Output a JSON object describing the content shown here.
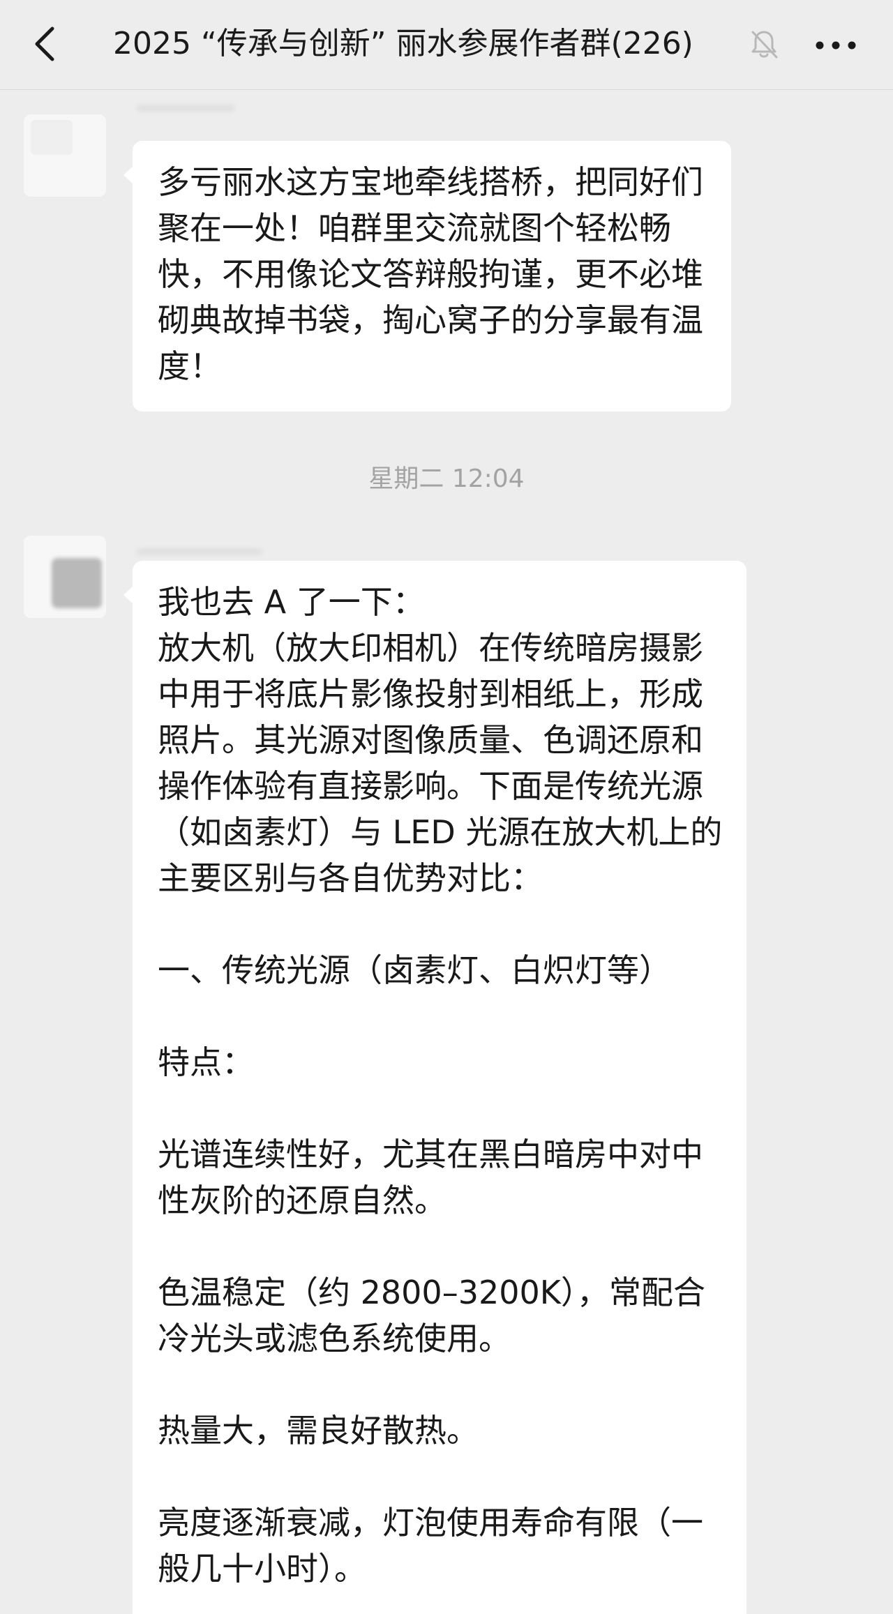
{
  "header": {
    "title": "2025 “传承与创新” 丽水参展作者群(226)",
    "back_icon": "chevron-left-icon",
    "mute_icon": "bell-off-icon",
    "more_icon": "more-horizontal-icon"
  },
  "messages": [
    {
      "text": "多亏丽水这方宝地牵线搭桥，把同好们聚在一处！咱群里交流就图个轻松畅快，不用像论文答辩般拘谨，更不必堆砌典故掉书袋，掏心窝子的分享最有温度！"
    },
    {
      "timestamp": "星期二 12:04"
    },
    {
      "text": "我也去 A 了一下：\n放大机（放大印相机）在传统暗房摄影中用于将底片影像投射到相纸上，形成照片。其光源对图像质量、色调还原和操作体验有直接影响。下面是传统光源（如卤素灯）与 LED 光源在放大机上的主要区别与各自优势对比：\n\n一、传统光源（卤素灯、白炽灯等）\n\n特点：\n\n光谱连续性好，尤其在黑白暗房中对中性灰阶的还原自然。\n\n色温稳定（约 2800–3200K），常配合冷光头或滤色系统使用。\n\n热量大，需良好散热。\n\n亮度逐渐衰减，灯泡使用寿命有限（一般几十小时）。"
    }
  ],
  "colors": {
    "background": "#ededed",
    "bubble": "#ffffff",
    "text": "#191919",
    "timestamp": "#a3a3a3"
  }
}
